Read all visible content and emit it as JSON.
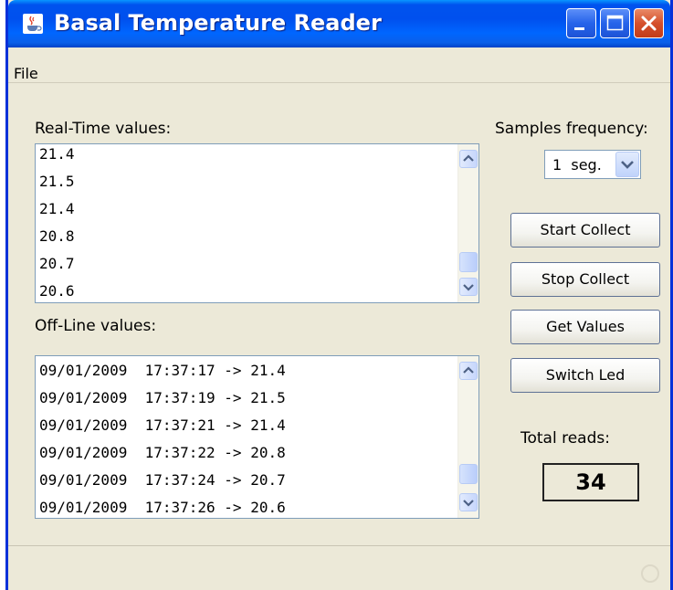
{
  "window": {
    "title": "Basal Temperature Reader"
  },
  "menu": {
    "file_label": "File"
  },
  "realtime": {
    "label": "Real-Time values:",
    "rows": [
      "21.4",
      "21.5",
      "21.4",
      "20.8",
      "20.7",
      "20.6"
    ]
  },
  "offline": {
    "label": "Off-Line values:",
    "rows": [
      "09/01/2009  17:37:17 -> 21.4",
      "09/01/2009  17:37:19 -> 21.5",
      "09/01/2009  17:37:21 -> 21.4",
      "09/01/2009  17:37:22 -> 20.8",
      "09/01/2009  17:37:24 -> 20.7",
      "09/01/2009  17:37:26 -> 20.6"
    ]
  },
  "samples": {
    "label": "Samples frequency:",
    "selected": "1  seg."
  },
  "buttons": {
    "start": "Start Collect",
    "stop": "Stop Collect",
    "get": "Get Values",
    "led": "Switch Led"
  },
  "total": {
    "label": "Total reads:",
    "value": "34"
  },
  "icons": {
    "app": "java-cup-icon",
    "minimize": "minimize-icon",
    "maximize": "maximize-icon",
    "close": "close-icon",
    "scroll_up": "chevron-up-icon",
    "scroll_down": "chevron-down-icon",
    "dropdown": "chevron-down-icon",
    "status": "busy-spinner-icon"
  },
  "colors": {
    "titlebar": "#0053ee",
    "window_bg": "#ece9d8",
    "close_button": "#d5502c"
  }
}
